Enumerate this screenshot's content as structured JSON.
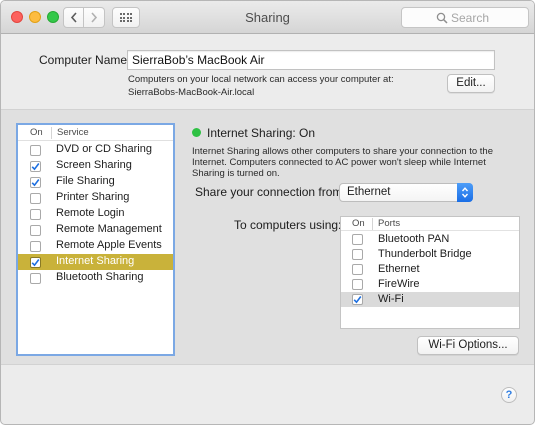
{
  "window": {
    "title": "Sharing"
  },
  "search": {
    "placeholder": "Search"
  },
  "computer_name": {
    "label": "Computer Name:",
    "value": "SierraBob’s MacBook Air",
    "desc_line1": "Computers on your local network can access your computer at:",
    "desc_line2": "SierraBobs-MacBook-Air.local",
    "edit_label": "Edit..."
  },
  "services": {
    "col_on": "On",
    "col_service": "Service",
    "items": [
      {
        "name": "DVD or CD Sharing",
        "checked": false,
        "selected": false
      },
      {
        "name": "Screen Sharing",
        "checked": true,
        "selected": false
      },
      {
        "name": "File Sharing",
        "checked": true,
        "selected": false
      },
      {
        "name": "Printer Sharing",
        "checked": false,
        "selected": false
      },
      {
        "name": "Remote Login",
        "checked": false,
        "selected": false
      },
      {
        "name": "Remote Management",
        "checked": false,
        "selected": false
      },
      {
        "name": "Remote Apple Events",
        "checked": false,
        "selected": false
      },
      {
        "name": "Internet Sharing",
        "checked": true,
        "selected": true
      },
      {
        "name": "Bluetooth Sharing",
        "checked": false,
        "selected": false
      }
    ]
  },
  "internet_sharing": {
    "status": "Internet Sharing: On",
    "status_color": "#2fc144",
    "desc_line1": "Internet Sharing allows other computers to share your connection to the",
    "desc_line2": "Internet. Computers connected to AC power won't sleep while Internet",
    "desc_line3": "Sharing is turned on.",
    "share_from_label": "Share your connection from:",
    "share_from_value": "Ethernet",
    "to_computers_label": "To computers using:",
    "ports_col_on": "On",
    "ports_col_ports": "Ports",
    "ports": [
      {
        "name": "Bluetooth PAN",
        "checked": false,
        "selected": false
      },
      {
        "name": "Thunderbolt Bridge",
        "checked": false,
        "selected": false
      },
      {
        "name": "Ethernet",
        "checked": false,
        "selected": false
      },
      {
        "name": "FireWire",
        "checked": false,
        "selected": false
      },
      {
        "name": "Wi-Fi",
        "checked": true,
        "selected": true
      }
    ],
    "wifi_options_label": "Wi-Fi Options..."
  },
  "help": {
    "label": "?"
  },
  "colors": {
    "selection": "#c9b23a",
    "accent": "#1a6ee6",
    "focus_ring": "#7ba8e4"
  }
}
